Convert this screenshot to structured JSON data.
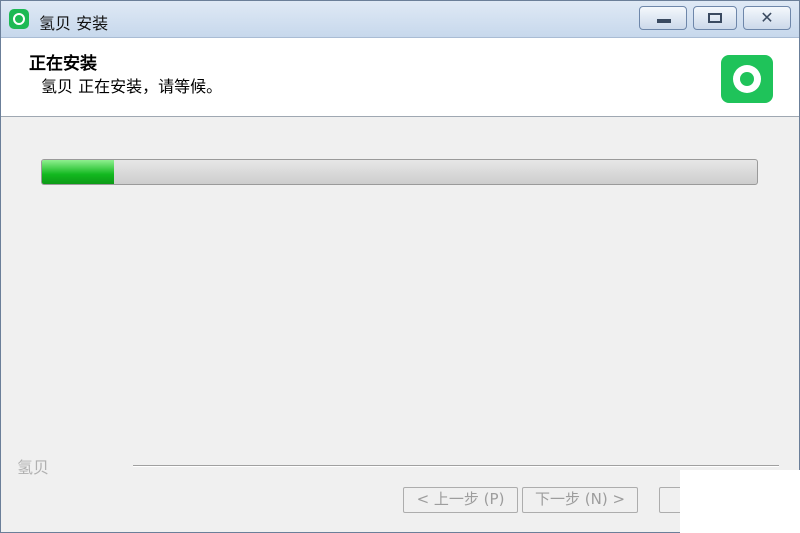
{
  "window": {
    "title": "氢贝 安装",
    "controls": {
      "close_glyph": "✕"
    }
  },
  "header": {
    "title": "正在安装",
    "subtitle": "氢贝 正在安装，请等候。",
    "logo_icon": "qingbei-logo"
  },
  "progress": {
    "percent": 10
  },
  "footer": {
    "brand": "氢贝",
    "back_label": "< 上一步 (P)",
    "next_label": "下一步 (N) >",
    "third_label": ""
  },
  "colors": {
    "accent": "#1fc35a",
    "progress_fill": "#12b81f",
    "disabled_text": "#9d9d9d"
  }
}
